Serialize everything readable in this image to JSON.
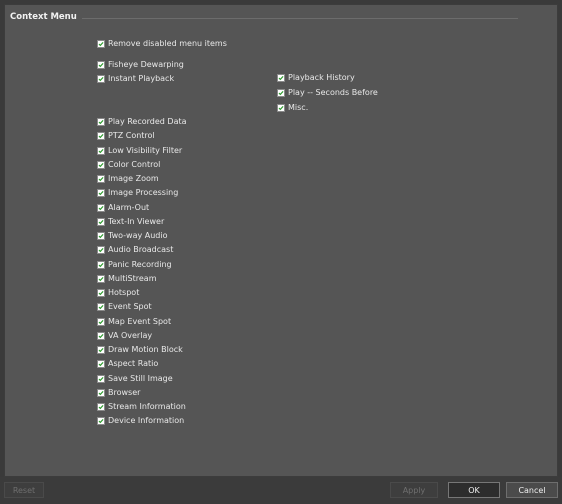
{
  "section": {
    "title": "Context Menu"
  },
  "remove_disabled": {
    "label": "Remove disabled menu items",
    "checked": true
  },
  "col1_top": [
    {
      "label": "Fisheye Dewarping",
      "checked": true
    },
    {
      "label": "Instant Playback",
      "checked": true
    }
  ],
  "col2": [
    {
      "label": "Playback History",
      "checked": true
    },
    {
      "label": "Play -- Seconds Before",
      "checked": true
    },
    {
      "label": "Misc.",
      "checked": true
    }
  ],
  "col1_list": [
    {
      "label": "Play Recorded Data",
      "checked": true
    },
    {
      "label": "PTZ Control",
      "checked": true
    },
    {
      "label": "Low Visibility Filter",
      "checked": true
    },
    {
      "label": "Color Control",
      "checked": true
    },
    {
      "label": "Image Zoom",
      "checked": true
    },
    {
      "label": "Image Processing",
      "checked": true
    },
    {
      "label": "Alarm-Out",
      "checked": true
    },
    {
      "label": "Text-In Viewer",
      "checked": true
    },
    {
      "label": "Two-way Audio",
      "checked": true
    },
    {
      "label": "Audio Broadcast",
      "checked": true
    },
    {
      "label": "Panic Recording",
      "checked": true
    },
    {
      "label": "MultiStream",
      "checked": true
    },
    {
      "label": "Hotspot",
      "checked": true
    },
    {
      "label": "Event Spot",
      "checked": true
    },
    {
      "label": "Map Event Spot",
      "checked": true
    },
    {
      "label": "VA Overlay",
      "checked": true
    },
    {
      "label": "Draw Motion Block",
      "checked": true
    },
    {
      "label": "Aspect Ratio",
      "checked": true
    },
    {
      "label": "Save Still Image",
      "checked": true
    },
    {
      "label": "Browser",
      "checked": true
    },
    {
      "label": "Stream Information",
      "checked": true
    },
    {
      "label": "Device Information",
      "checked": true
    }
  ],
  "footer": {
    "reset_label": "Reset",
    "apply_label": "Apply",
    "ok_label": "OK",
    "cancel_label": "Cancel"
  },
  "colors": {
    "check": "#2e9c2e",
    "panel": "#555555",
    "footer": "#3b3b3b"
  }
}
